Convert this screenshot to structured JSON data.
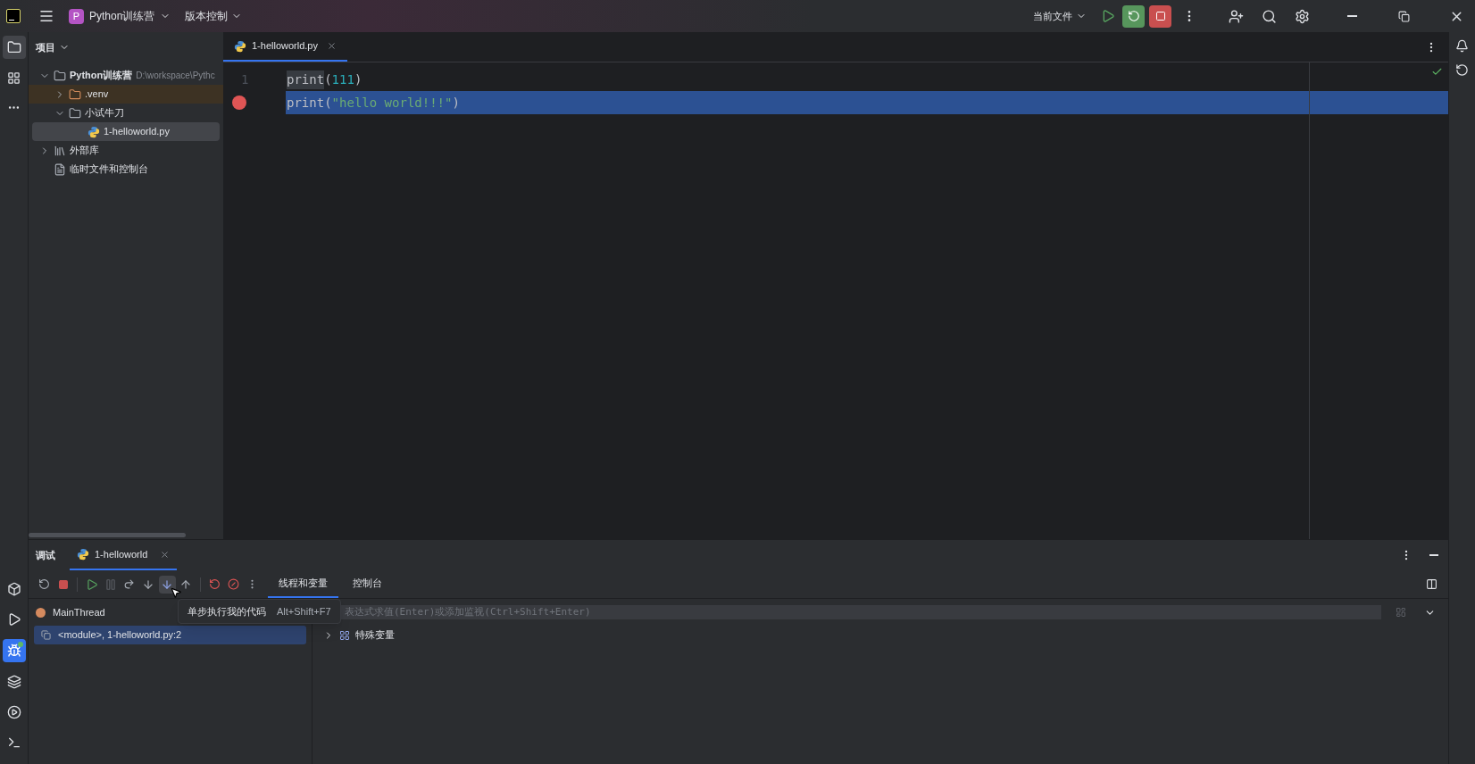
{
  "titlebar": {
    "project_badge": "P",
    "project_name": "Python训练营",
    "vcs": "版本控制",
    "run_config": "当前文件"
  },
  "project_panel": {
    "title": "项目",
    "tree": [
      {
        "label": "Python训练营",
        "path": "D:\\workspace\\Pythc",
        "kind": "project",
        "expanded": true,
        "selected": false,
        "children": [
          {
            "label": ".venv",
            "kind": "excluded",
            "expanded": false,
            "selected": false
          },
          {
            "label": "小试牛刀",
            "kind": "folder",
            "expanded": true,
            "selected": false,
            "children": [
              {
                "label": "1-helloworld.py",
                "kind": "python",
                "selected": true
              }
            ]
          }
        ]
      },
      {
        "label": "外部库",
        "kind": "library",
        "expanded": false,
        "selected": false
      },
      {
        "label": "临时文件和控制台",
        "kind": "scratch",
        "selected": false
      }
    ]
  },
  "editor": {
    "tabs": [
      {
        "label": "1-helloworld.py",
        "selected": true
      }
    ],
    "lines": [
      {
        "number": "1",
        "breakpoint": false,
        "current": false,
        "tokens": [
          {
            "text": "print",
            "kind": "call"
          },
          {
            "text": "(",
            "kind": "punct"
          },
          {
            "text": "111",
            "kind": "number"
          },
          {
            "text": ")",
            "kind": "punct"
          }
        ]
      },
      {
        "breakpoint": true,
        "current": true,
        "tokens": [
          {
            "text": "print",
            "kind": "call"
          },
          {
            "text": "(",
            "kind": "punct"
          },
          {
            "text": "\"hello world!!!\"",
            "kind": "string"
          },
          {
            "text": ")",
            "kind": "punct"
          }
        ]
      }
    ]
  },
  "debug": {
    "title": "调试",
    "sessions": [
      {
        "label": "1-helloworld",
        "selected": true
      }
    ],
    "views": [
      {
        "label": "线程和变量",
        "selected": true
      },
      {
        "label": "控制台",
        "selected": false
      }
    ],
    "thread": "MainThread",
    "frames": [
      {
        "label": "<module>, 1-helloworld.py:2",
        "selected": true
      }
    ],
    "eval_placeholder": "表达式求值(Enter)或添加监视(Ctrl+Shift+Enter)",
    "variables": [
      {
        "label": "特殊变量",
        "expanded": false
      }
    ],
    "tooltip": {
      "text": "单步执行我的代码",
      "shortcut": "Alt+Shift+F7"
    }
  }
}
